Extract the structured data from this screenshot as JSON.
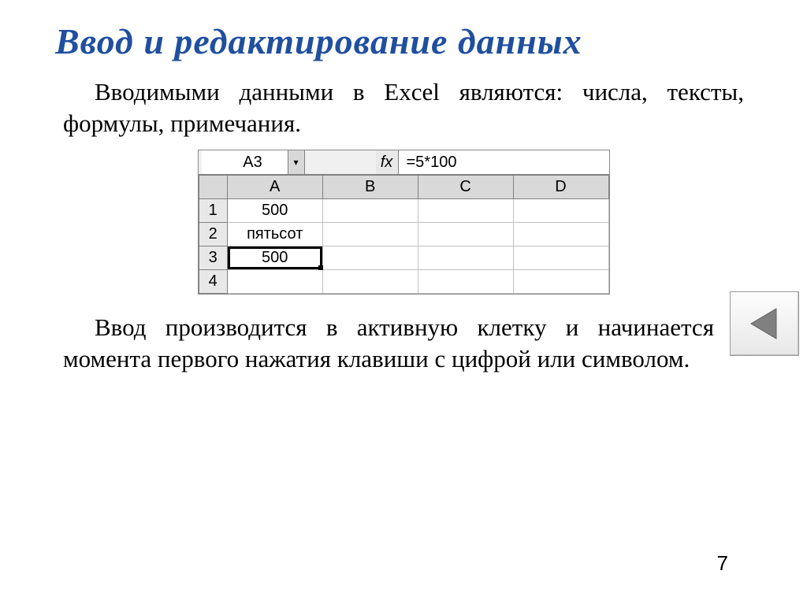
{
  "title": "Ввод и редактирование данных",
  "paragraph1": "Вводимыми данными в Excel являются: числа, тексты, формулы, примечания.",
  "paragraph2": "Ввод производится в активную клетку и начинается с момента первого нажатия клавиши с цифрой или символом.",
  "page_number": "7",
  "excel": {
    "name_box": "A3",
    "fx_label": "fx",
    "formula": "=5*100",
    "col_headers": [
      "A",
      "B",
      "C",
      "D"
    ],
    "row_headers": [
      "1",
      "2",
      "3",
      "4"
    ],
    "cells": {
      "A1": "500",
      "A2": "пятьсот",
      "A3": "500"
    },
    "selected_col": "A",
    "selected_row": "3",
    "active_cell": "A3"
  },
  "chevron_small": "▾"
}
